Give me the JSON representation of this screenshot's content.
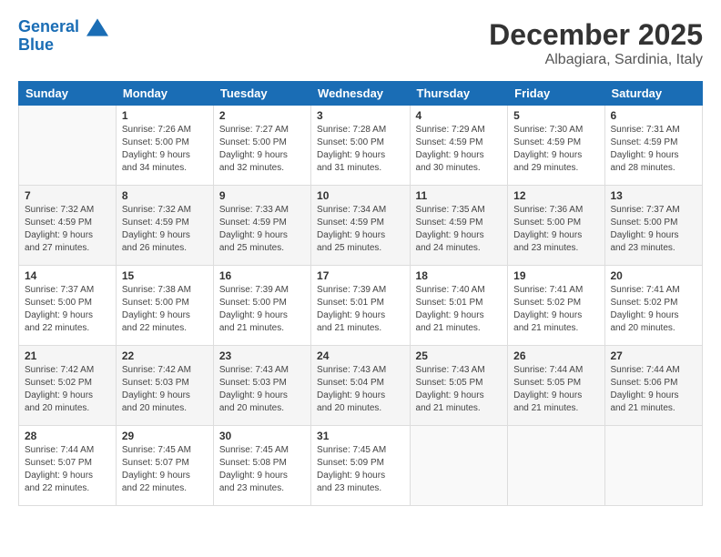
{
  "logo": {
    "line1": "General",
    "line2": "Blue"
  },
  "header": {
    "month": "December 2025",
    "location": "Albagiara, Sardinia, Italy"
  },
  "weekdays": [
    "Sunday",
    "Monday",
    "Tuesday",
    "Wednesday",
    "Thursday",
    "Friday",
    "Saturday"
  ],
  "weeks": [
    [
      {
        "day": "",
        "info": ""
      },
      {
        "day": "1",
        "info": "Sunrise: 7:26 AM\nSunset: 5:00 PM\nDaylight: 9 hours\nand 34 minutes."
      },
      {
        "day": "2",
        "info": "Sunrise: 7:27 AM\nSunset: 5:00 PM\nDaylight: 9 hours\nand 32 minutes."
      },
      {
        "day": "3",
        "info": "Sunrise: 7:28 AM\nSunset: 5:00 PM\nDaylight: 9 hours\nand 31 minutes."
      },
      {
        "day": "4",
        "info": "Sunrise: 7:29 AM\nSunset: 4:59 PM\nDaylight: 9 hours\nand 30 minutes."
      },
      {
        "day": "5",
        "info": "Sunrise: 7:30 AM\nSunset: 4:59 PM\nDaylight: 9 hours\nand 29 minutes."
      },
      {
        "day": "6",
        "info": "Sunrise: 7:31 AM\nSunset: 4:59 PM\nDaylight: 9 hours\nand 28 minutes."
      }
    ],
    [
      {
        "day": "7",
        "info": "Sunrise: 7:32 AM\nSunset: 4:59 PM\nDaylight: 9 hours\nand 27 minutes."
      },
      {
        "day": "8",
        "info": "Sunrise: 7:32 AM\nSunset: 4:59 PM\nDaylight: 9 hours\nand 26 minutes."
      },
      {
        "day": "9",
        "info": "Sunrise: 7:33 AM\nSunset: 4:59 PM\nDaylight: 9 hours\nand 25 minutes."
      },
      {
        "day": "10",
        "info": "Sunrise: 7:34 AM\nSunset: 4:59 PM\nDaylight: 9 hours\nand 25 minutes."
      },
      {
        "day": "11",
        "info": "Sunrise: 7:35 AM\nSunset: 4:59 PM\nDaylight: 9 hours\nand 24 minutes."
      },
      {
        "day": "12",
        "info": "Sunrise: 7:36 AM\nSunset: 5:00 PM\nDaylight: 9 hours\nand 23 minutes."
      },
      {
        "day": "13",
        "info": "Sunrise: 7:37 AM\nSunset: 5:00 PM\nDaylight: 9 hours\nand 23 minutes."
      }
    ],
    [
      {
        "day": "14",
        "info": "Sunrise: 7:37 AM\nSunset: 5:00 PM\nDaylight: 9 hours\nand 22 minutes."
      },
      {
        "day": "15",
        "info": "Sunrise: 7:38 AM\nSunset: 5:00 PM\nDaylight: 9 hours\nand 22 minutes."
      },
      {
        "day": "16",
        "info": "Sunrise: 7:39 AM\nSunset: 5:00 PM\nDaylight: 9 hours\nand 21 minutes."
      },
      {
        "day": "17",
        "info": "Sunrise: 7:39 AM\nSunset: 5:01 PM\nDaylight: 9 hours\nand 21 minutes."
      },
      {
        "day": "18",
        "info": "Sunrise: 7:40 AM\nSunset: 5:01 PM\nDaylight: 9 hours\nand 21 minutes."
      },
      {
        "day": "19",
        "info": "Sunrise: 7:41 AM\nSunset: 5:02 PM\nDaylight: 9 hours\nand 21 minutes."
      },
      {
        "day": "20",
        "info": "Sunrise: 7:41 AM\nSunset: 5:02 PM\nDaylight: 9 hours\nand 20 minutes."
      }
    ],
    [
      {
        "day": "21",
        "info": "Sunrise: 7:42 AM\nSunset: 5:02 PM\nDaylight: 9 hours\nand 20 minutes."
      },
      {
        "day": "22",
        "info": "Sunrise: 7:42 AM\nSunset: 5:03 PM\nDaylight: 9 hours\nand 20 minutes."
      },
      {
        "day": "23",
        "info": "Sunrise: 7:43 AM\nSunset: 5:03 PM\nDaylight: 9 hours\nand 20 minutes."
      },
      {
        "day": "24",
        "info": "Sunrise: 7:43 AM\nSunset: 5:04 PM\nDaylight: 9 hours\nand 20 minutes."
      },
      {
        "day": "25",
        "info": "Sunrise: 7:43 AM\nSunset: 5:05 PM\nDaylight: 9 hours\nand 21 minutes."
      },
      {
        "day": "26",
        "info": "Sunrise: 7:44 AM\nSunset: 5:05 PM\nDaylight: 9 hours\nand 21 minutes."
      },
      {
        "day": "27",
        "info": "Sunrise: 7:44 AM\nSunset: 5:06 PM\nDaylight: 9 hours\nand 21 minutes."
      }
    ],
    [
      {
        "day": "28",
        "info": "Sunrise: 7:44 AM\nSunset: 5:07 PM\nDaylight: 9 hours\nand 22 minutes."
      },
      {
        "day": "29",
        "info": "Sunrise: 7:45 AM\nSunset: 5:07 PM\nDaylight: 9 hours\nand 22 minutes."
      },
      {
        "day": "30",
        "info": "Sunrise: 7:45 AM\nSunset: 5:08 PM\nDaylight: 9 hours\nand 23 minutes."
      },
      {
        "day": "31",
        "info": "Sunrise: 7:45 AM\nSunset: 5:09 PM\nDaylight: 9 hours\nand 23 minutes."
      },
      {
        "day": "",
        "info": ""
      },
      {
        "day": "",
        "info": ""
      },
      {
        "day": "",
        "info": ""
      }
    ]
  ]
}
